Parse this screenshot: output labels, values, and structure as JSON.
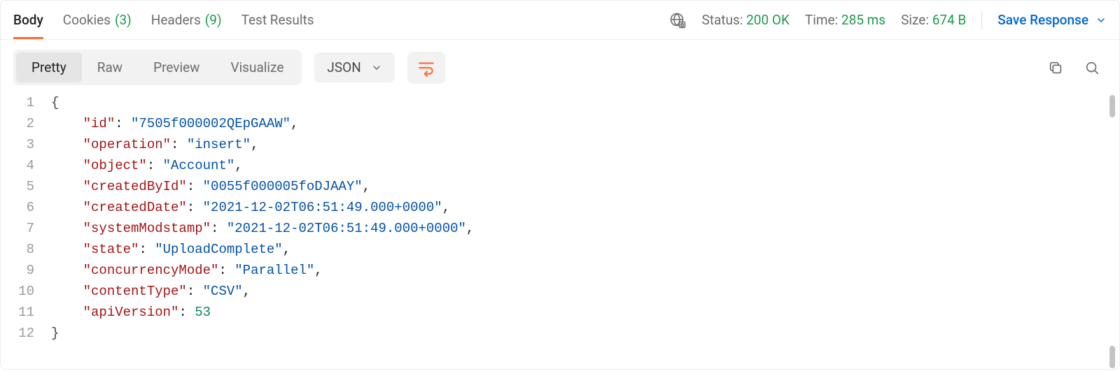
{
  "tabs": {
    "body": {
      "label": "Body"
    },
    "cookies": {
      "label": "Cookies",
      "count": "(3)"
    },
    "headers": {
      "label": "Headers",
      "count": "(9)"
    },
    "tests": {
      "label": "Test Results"
    }
  },
  "status": {
    "status_label": "Status:",
    "status_value": "200 OK",
    "time_label": "Time:",
    "time_value": "285 ms",
    "size_label": "Size:",
    "size_value": "674 B",
    "save": "Save Response"
  },
  "toolbar": {
    "pretty": "Pretty",
    "raw": "Raw",
    "preview": "Preview",
    "visualize": "Visualize",
    "format": "JSON"
  },
  "response_body": {
    "id": "7505f000002QEpGAAW",
    "operation": "insert",
    "object": "Account",
    "createdById": "0055f000005foDJAAY",
    "createdDate": "2021-12-02T06:51:49.000+0000",
    "systemModstamp": "2021-12-02T06:51:49.000+0000",
    "state": "UploadComplete",
    "concurrencyMode": "Parallel",
    "contentType": "CSV",
    "apiVersion": 53.0
  }
}
